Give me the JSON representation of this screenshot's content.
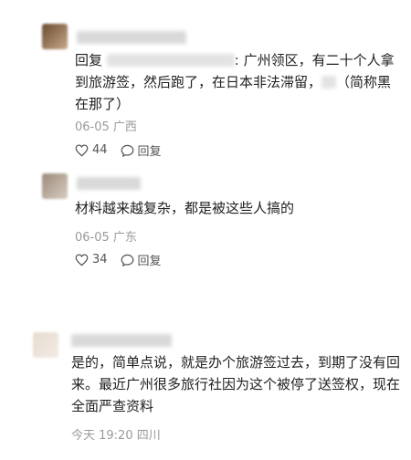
{
  "comments": [
    {
      "reply_prefix": "回复",
      "text_part1": ": 广州领区，有二十个人拿到旅游签，然后跑了，在日本非法滞留，",
      "text_part2": "（简称黑在那了）",
      "meta": "06-05 广西",
      "likes": "44",
      "reply_label": "回复",
      "avatar_color": "#8a6a4a"
    },
    {
      "text": "材料越来越复杂，都是被这些人搞的",
      "meta": "06-05 广东",
      "likes": "34",
      "reply_label": "回复",
      "avatar_color": "#a89a8a"
    },
    {
      "text": "是的，简单点说，就是办个旅游签过去，到期了没有回来。最近广州很多旅行社因为这个被停了送签权，现在全面严查资料",
      "meta": "今天 19:20 四川"
    }
  ],
  "icons": {
    "like": "heart-outline-icon",
    "reply": "speech-bubble-icon"
  }
}
